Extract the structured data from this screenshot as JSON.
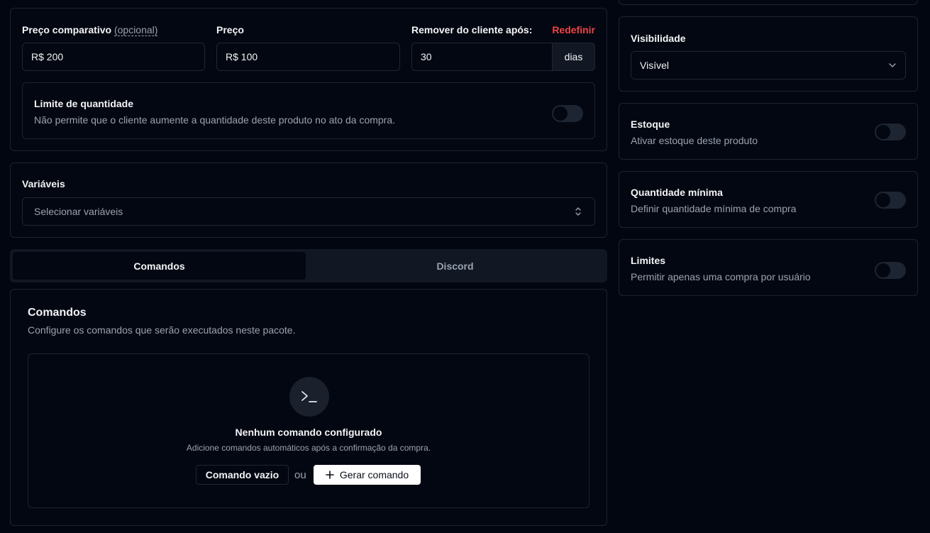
{
  "pricing": {
    "compare_label": "Preço comparativo",
    "compare_optional": "(opcional)",
    "compare_value": "R$ 200",
    "price_label": "Preço",
    "price_value": "R$ 100",
    "remove_label": "Remover do cliente após:",
    "reset_label": "Redefinir",
    "remove_value": "30",
    "remove_unit": "dias",
    "limit_title": "Limite de quantidade",
    "limit_desc": "Não permite que o cliente aumente a quantidade deste produto no ato da compra."
  },
  "variables": {
    "label": "Variáveis",
    "placeholder": "Selecionar variáveis"
  },
  "tabs": [
    {
      "label": "Comandos",
      "active": true
    },
    {
      "label": "Discord",
      "active": false
    }
  ],
  "commands": {
    "title": "Comandos",
    "subtitle": "Configure os comandos que serão executados neste pacote.",
    "empty_icon": "terminal-icon",
    "empty_title": "Nenhum comando configurado",
    "empty_desc": "Adicione comandos automáticos após a confirmação da compra.",
    "empty_button": "Comando vazio",
    "or_text": "ou",
    "generate_button": "Gerar comando"
  },
  "sidebar": {
    "visibility_label": "Visibilidade",
    "visibility_value": "Visível",
    "stock_title": "Estoque",
    "stock_desc": "Ativar estoque deste produto",
    "minqty_title": "Quantidade mínima",
    "minqty_desc": "Definir quantidade mínima de compra",
    "limits_title": "Limites",
    "limits_desc": "Permitir apenas uma compra por usuário"
  },
  "colors": {
    "background": "#020610",
    "accent_red": "#ef4444",
    "border": "#1c2330"
  }
}
